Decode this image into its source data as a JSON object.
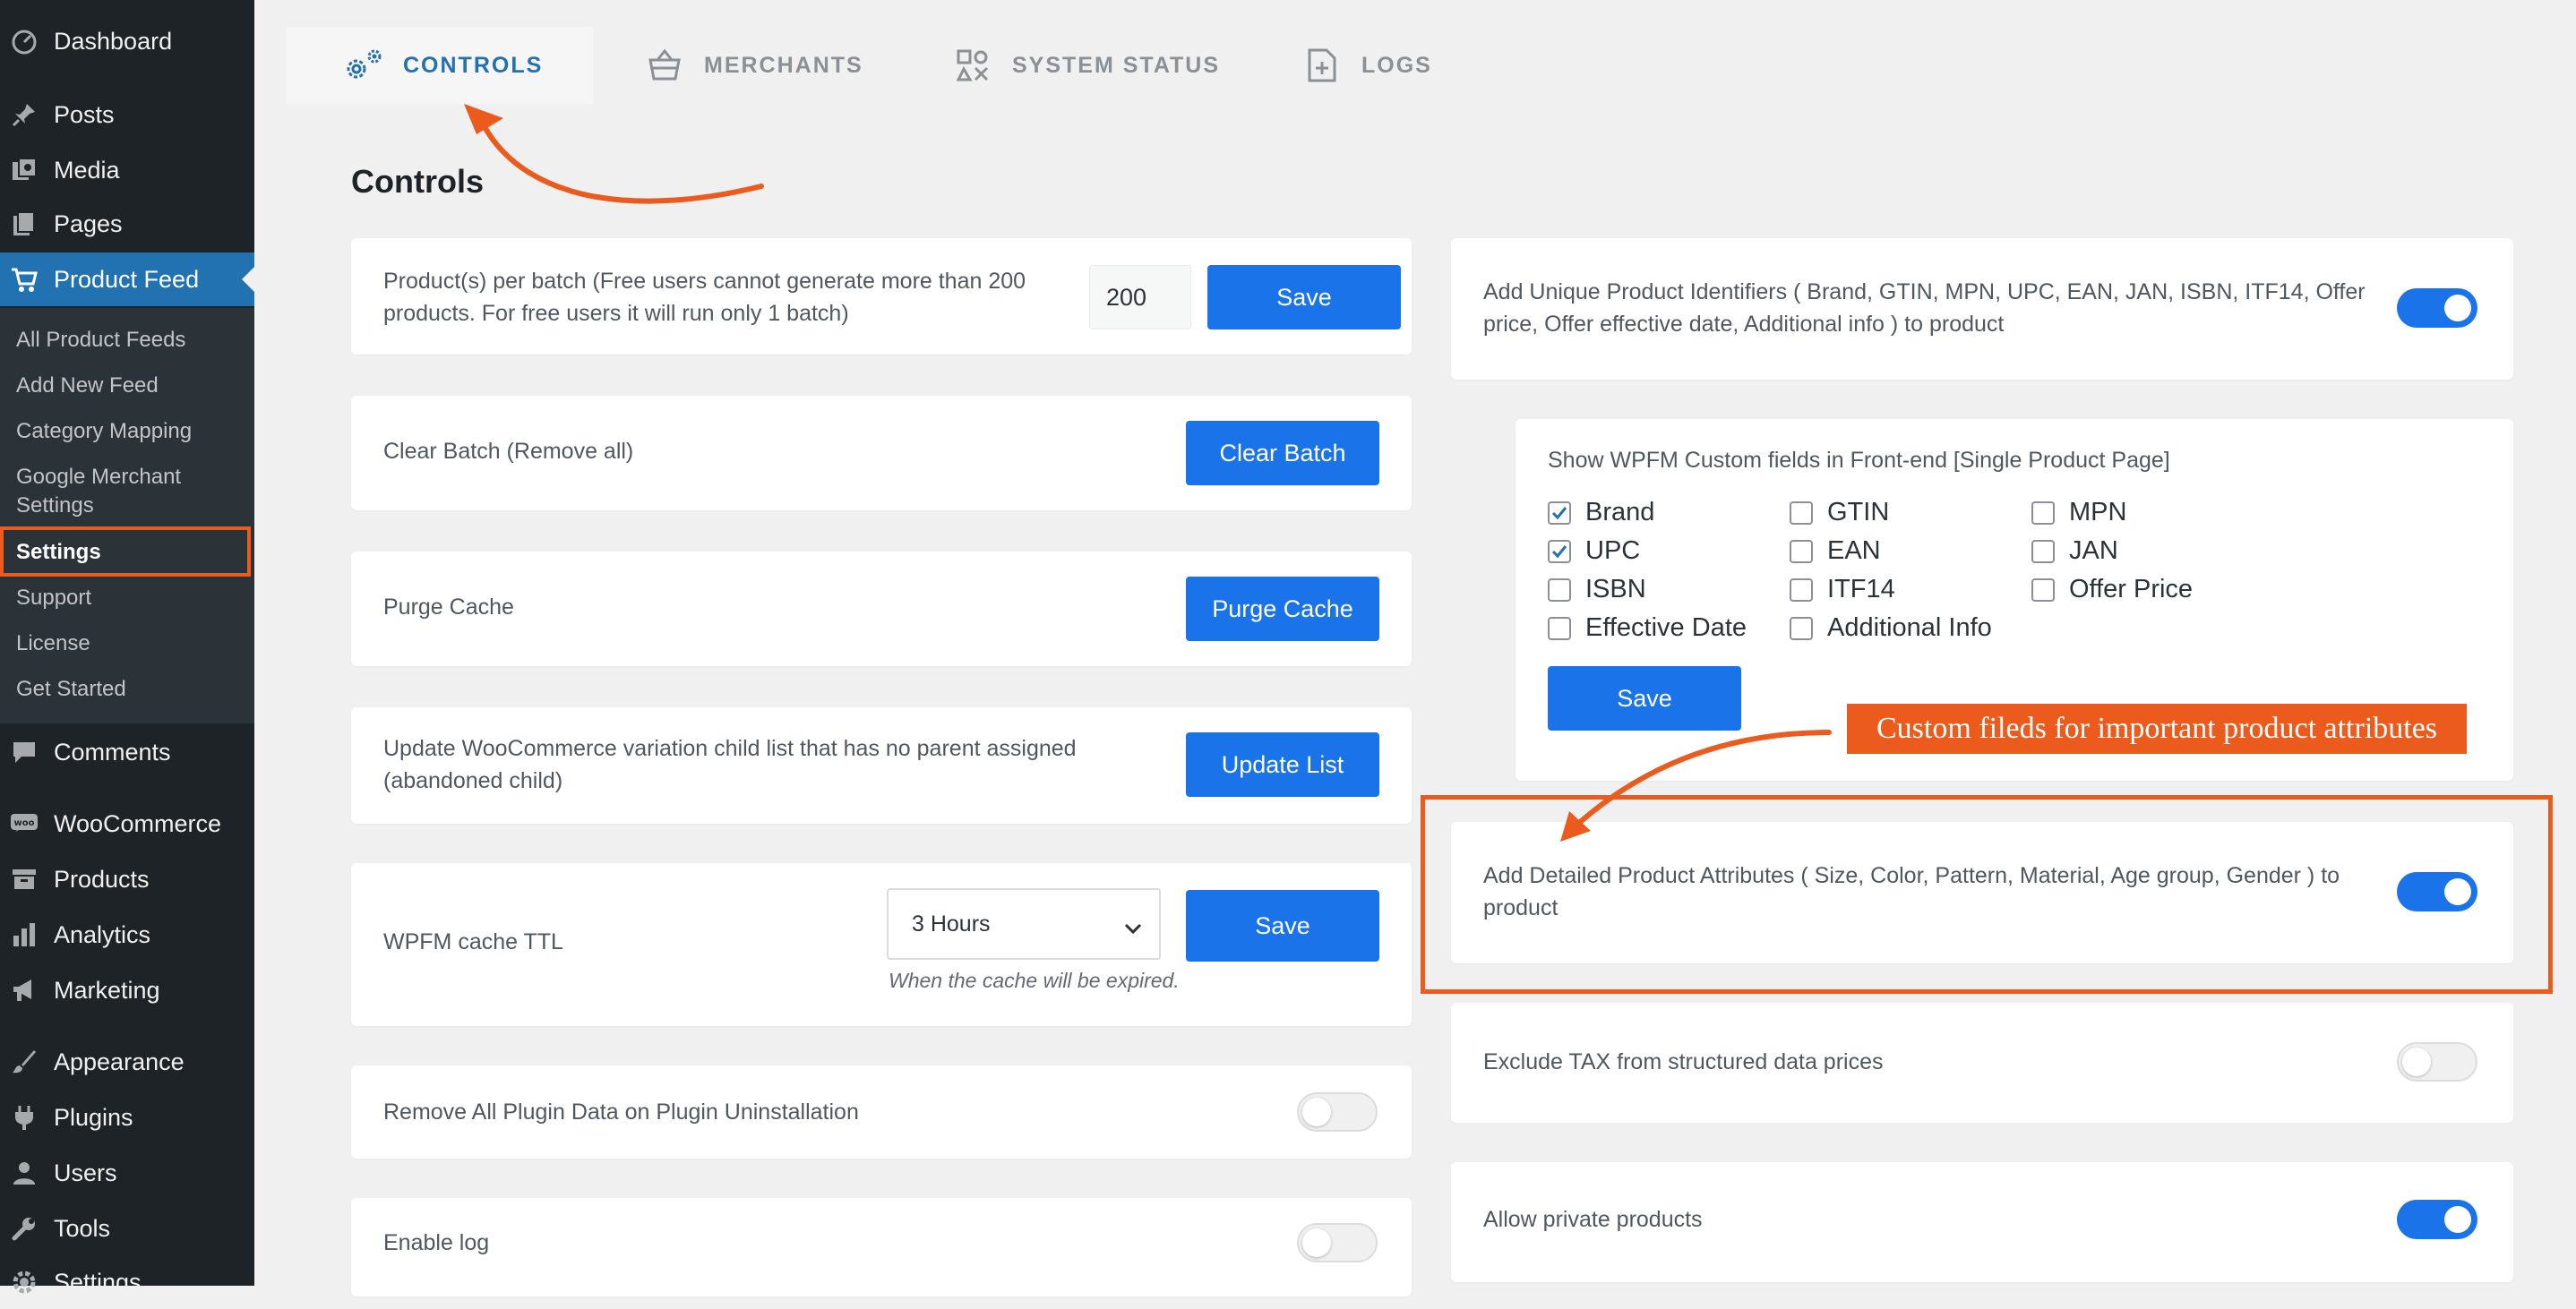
{
  "sidebar": {
    "items": [
      {
        "label": "Dashboard",
        "icon": "dashboard-icon"
      },
      {
        "label": "Posts",
        "icon": "pin-icon"
      },
      {
        "label": "Media",
        "icon": "media-icon"
      },
      {
        "label": "Pages",
        "icon": "pages-icon"
      },
      {
        "label": "Product Feed",
        "icon": "cart-icon"
      },
      {
        "label": "Comments",
        "icon": "comment-icon"
      },
      {
        "label": "WooCommerce",
        "icon": "woo-icon"
      },
      {
        "label": "Products",
        "icon": "archive-icon"
      },
      {
        "label": "Analytics",
        "icon": "bar-chart-icon"
      },
      {
        "label": "Marketing",
        "icon": "megaphone-icon"
      },
      {
        "label": "Appearance",
        "icon": "brush-icon"
      },
      {
        "label": "Plugins",
        "icon": "plug-icon"
      },
      {
        "label": "Users",
        "icon": "user-icon"
      },
      {
        "label": "Tools",
        "icon": "wrench-icon"
      },
      {
        "label": "Settings",
        "icon": "settings-icon"
      }
    ],
    "submenu": [
      "All Product Feeds",
      "Add New Feed",
      "Category Mapping",
      "Google Merchant",
      "Settings",
      "Settings",
      "Support",
      "License",
      "Get Started"
    ]
  },
  "tabs": [
    {
      "label": "CONTROLS",
      "icon": "gears-icon"
    },
    {
      "label": "MERCHANTS",
      "icon": "basket-icon"
    },
    {
      "label": "SYSTEM STATUS",
      "icon": "status-icon"
    },
    {
      "label": "LOGS",
      "icon": "log-file-icon"
    }
  ],
  "page_title": "Controls",
  "left_cards": {
    "batch": {
      "text_line1": "Product(s) per batch (Free users cannot generate more than 200",
      "text_line2": "products. For free users it will run only 1 batch)",
      "value": "200",
      "button": "Save"
    },
    "clear_batch": {
      "text": "Clear Batch (Remove all)",
      "button": "Clear Batch"
    },
    "purge_cache": {
      "text": "Purge Cache",
      "button": "Purge Cache"
    },
    "update_list": {
      "text_line1": "Update WooCommerce variation child list that has no parent assigned",
      "text_line2": "(abandoned child)",
      "button": "Update List"
    },
    "cache_ttl": {
      "text": "WPFM cache TTL",
      "selected": "3 Hours",
      "button": "Save",
      "hint": "When the cache will be expired."
    },
    "remove_data": {
      "text": "Remove All Plugin Data on Plugin Uninstallation",
      "enabled": false
    },
    "enable_log": {
      "text": "Enable log",
      "enabled": false
    }
  },
  "right_cards": {
    "unique_ids": {
      "text_line1": "Add Unique Product Identifiers ( Brand, GTIN, MPN, UPC, EAN, JAN, ISBN, ITF14, Offer",
      "text_line2": "price, Offer effective date, Additional info ) to product",
      "enabled": true
    },
    "custom_fields": {
      "title": "Show WPFM Custom fields in Front-end [Single Product Page]",
      "options": [
        {
          "label": "Brand",
          "checked": true
        },
        {
          "label": "GTIN",
          "checked": false
        },
        {
          "label": "MPN",
          "checked": false
        },
        {
          "label": "UPC",
          "checked": true
        },
        {
          "label": "EAN",
          "checked": false
        },
        {
          "label": "JAN",
          "checked": false
        },
        {
          "label": "ISBN",
          "checked": false
        },
        {
          "label": "ITF14",
          "checked": false
        },
        {
          "label": "Offer Price",
          "checked": false
        },
        {
          "label": "Effective Date",
          "checked": false
        },
        {
          "label": "Additional Info",
          "checked": false
        }
      ],
      "button": "Save"
    },
    "detailed_attrs": {
      "text_line1": "Add Detailed Product Attributes ( Size, Color, Pattern, Material, Age group, Gender ) to",
      "text_line2": "product",
      "enabled": true
    },
    "exclude_tax": {
      "text": "Exclude TAX from structured data prices",
      "enabled": false
    },
    "private_products": {
      "text": "Allow private products",
      "enabled": true
    }
  },
  "annotation": {
    "callout": "Custom fileds for important product attributes"
  },
  "colors": {
    "accent": "#1a73e8",
    "wp_blue": "#2271b1",
    "annotation": "#ea5b1d",
    "sidebar": "#1d2327"
  }
}
